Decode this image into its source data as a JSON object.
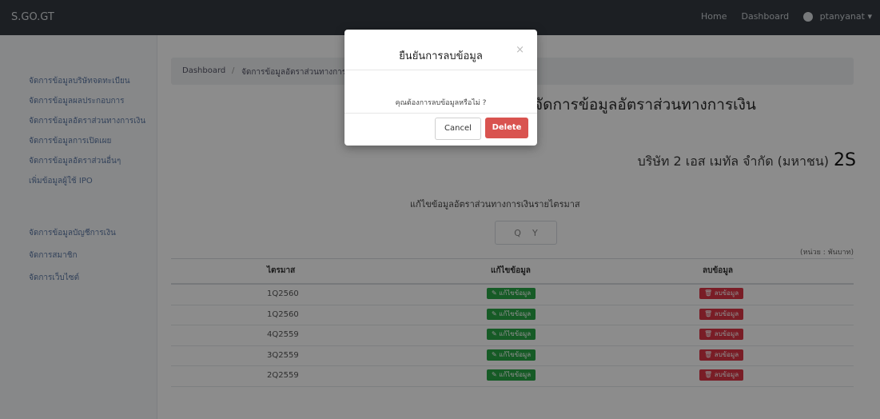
{
  "navbar": {
    "brand": "S.GO.GT",
    "links": [
      "Home",
      "Dashboard"
    ],
    "user": "ptanyanat"
  },
  "sidebar": {
    "items": [
      {
        "label": "จัดการข้อมูลบริษัทจดทะเบียน"
      },
      {
        "label": "จัดการข้อมูลผลประกอบการ"
      },
      {
        "label": "จัดการข้อมูลอัตราส่วนทางการเงิน"
      },
      {
        "label": "จัดการข้อมูลการเปิดเผย"
      },
      {
        "label": "จัดการข้อมูลอัตราส่วนอื่นๆ"
      },
      {
        "label": "เพิ่มข้อมูลผู้ใช้ IPO"
      },
      {
        "label": "จัดการข้อมูลบัญชีการเงิน"
      },
      {
        "label": "จัดการสมาชิก"
      },
      {
        "label": "จัดการเว็บไซต์"
      }
    ]
  },
  "breadcrumb": [
    "Dashboard",
    "จัดการข้อมูลอัตราส่วนทางการเงิน"
  ],
  "page_title": "จัดการข้อมูลอัตราส่วนทางการเงิน",
  "company": {
    "name": "บริษัท 2 เอส เมทัล จำกัด (มหาชน)",
    "code": "2S"
  },
  "subheading": "แก้ไขข้อมูลอัตราส่วนทางการเงินรายไตรมาส",
  "filter": {
    "q": "Q",
    "y": "Y"
  },
  "top_right_label": "(หน่วย : พันบาท)",
  "table": {
    "headers": [
      "ไตรมาส",
      "แก้ไขข้อมูล",
      "ลบข้อมูล"
    ],
    "rows": [
      {
        "period": "1Q2560",
        "edit": "แก้ไขข้อมูล",
        "delete": "ลบข้อมูล"
      },
      {
        "period": "1Q2560",
        "edit": "แก้ไขข้อมูล",
        "delete": "ลบข้อมูล"
      },
      {
        "period": "4Q2559",
        "edit": "แก้ไขข้อมูล",
        "delete": "ลบข้อมูล"
      },
      {
        "period": "3Q2559",
        "edit": "แก้ไขข้อมูล",
        "delete": "ลบข้อมูล"
      },
      {
        "period": "2Q2559",
        "edit": "แก้ไขข้อมูล",
        "delete": "ลบข้อมูล"
      }
    ]
  },
  "modal": {
    "title": "ยืนยันการลบข้อมูล",
    "close": "×",
    "body": "คุณต้องการลบข้อมูลหรือไม่ ?",
    "cancel": "Cancel",
    "delete": "Delete"
  }
}
